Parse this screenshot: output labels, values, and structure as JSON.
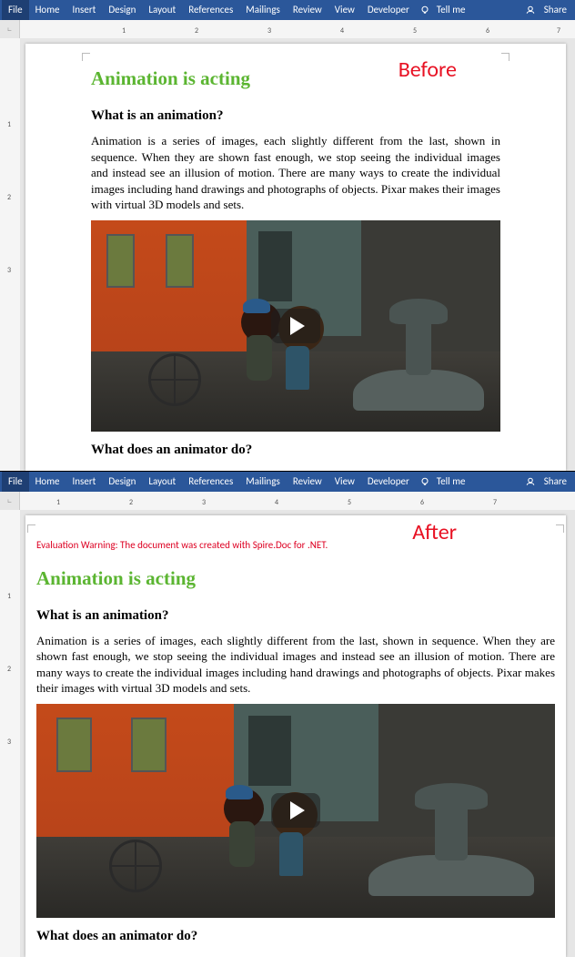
{
  "ribbon": {
    "tabs": [
      "File",
      "Home",
      "Insert",
      "Design",
      "Layout",
      "References",
      "Mailings",
      "Review",
      "View",
      "Developer"
    ],
    "tellme": "Tell me",
    "share": "Share"
  },
  "ruler": {
    "h_numbers": [
      "1",
      "2",
      "3",
      "4",
      "5",
      "6",
      "7"
    ],
    "v_numbers_before": [
      "1",
      "2",
      "3"
    ],
    "v_numbers_after": [
      "1",
      "2",
      "3"
    ]
  },
  "callouts": {
    "before": "Before",
    "after": "After"
  },
  "doc": {
    "eval_warning": "Evaluation Warning: The document was created with Spire.Doc for .NET.",
    "title": "Animation is acting",
    "h2_what_is": "What is an animation?",
    "p_what_is": "Animation is a series of images, each slightly different from the last, shown in sequence. When they are shown fast enough, we stop seeing the individual images and instead see an illusion of motion. There are many ways to create the individual images including hand drawings and photographs of objects. Pixar makes their images with virtual 3D models and sets.",
    "h2_animator": "What does an animator do?"
  }
}
